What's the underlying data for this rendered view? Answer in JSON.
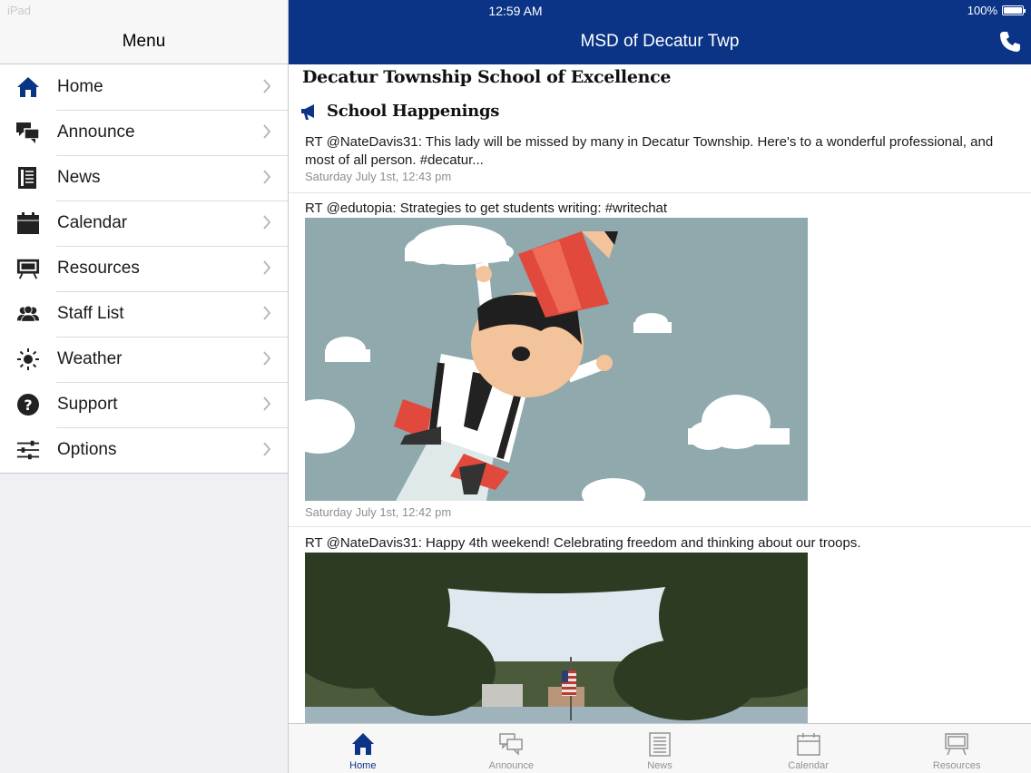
{
  "status_bar": {
    "carrier": "iPad",
    "time": "12:59 AM",
    "battery": "100%"
  },
  "sidebar": {
    "title": "Menu",
    "items": [
      {
        "label": "Home",
        "icon": "home-icon"
      },
      {
        "label": "Announce",
        "icon": "chat-bubbles-icon"
      },
      {
        "label": "News",
        "icon": "newspaper-icon"
      },
      {
        "label": "Calendar",
        "icon": "calendar-icon"
      },
      {
        "label": "Resources",
        "icon": "presentation-board-icon"
      },
      {
        "label": "Staff List",
        "icon": "people-icon"
      },
      {
        "label": "Weather",
        "icon": "sun-icon"
      },
      {
        "label": "Support",
        "icon": "question-circle-icon"
      },
      {
        "label": "Options",
        "icon": "sliders-icon"
      }
    ]
  },
  "header": {
    "title": "MSD of Decatur Twp",
    "phone_icon": "phone-icon"
  },
  "content": {
    "school_title": "Decatur Township School of Excellence",
    "section_title": "School Happenings",
    "posts": [
      {
        "text": "RT @NateDavis31: This lady will be missed by many in Decatur Township. Here's to a wonderful professional, and most of all person. #decatur...",
        "time": "Saturday July 1st, 12:43 pm"
      },
      {
        "text": "RT @edutopia: Strategies to get students writing: #writechat",
        "time": "Saturday July 1st, 12:42 pm",
        "image": "flying-pencil-boy-illustration"
      },
      {
        "text": "RT @NateDavis31: Happy 4th weekend! Celebrating freedom and thinking about our troops.",
        "image": "lake-trees-flag-photo"
      }
    ]
  },
  "tabbar": {
    "tabs": [
      {
        "label": "Home",
        "icon": "home-icon",
        "active": true
      },
      {
        "label": "Announce",
        "icon": "chat-bubbles-icon"
      },
      {
        "label": "News",
        "icon": "newspaper-icon"
      },
      {
        "label": "Calendar",
        "icon": "calendar-icon"
      },
      {
        "label": "Resources",
        "icon": "presentation-board-icon"
      }
    ]
  },
  "colors": {
    "brand": "#0b3487",
    "sidebar_bg": "#efeff4",
    "inactive_tab": "#929292",
    "sky": "#8fa9ad",
    "pencil_red": "#e0493c"
  }
}
